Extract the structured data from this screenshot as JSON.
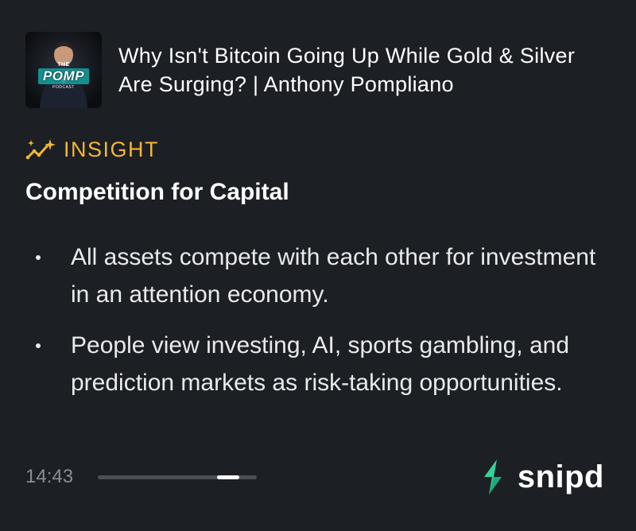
{
  "podcast": {
    "artwork": {
      "text_top": "THE",
      "text_main": "POMP",
      "text_bottom": "PODCAST"
    },
    "episode_title": "Why Isn't Bitcoin Going Up While Gold & Silver Are Surging? | Anthony Pompliano"
  },
  "insight": {
    "label": "INSIGHT",
    "icon": "sparkle-trend-icon",
    "accent_color": "#f5b731",
    "title": "Competition for Capital",
    "bullets": [
      "All assets compete with each other for investment in an attention economy.",
      "People view investing, AI, sports gambling, and prediction markets as risk-taking opportunities."
    ]
  },
  "player": {
    "timestamp": "14:43",
    "progress_fraction": 0.82
  },
  "brand": {
    "name": "snipd",
    "logo_icon": "snipd-logo-icon",
    "logo_color": "#33d39a"
  },
  "colors": {
    "background": "#1c1f24",
    "text": "#ffffff",
    "muted": "#8a8e94"
  }
}
